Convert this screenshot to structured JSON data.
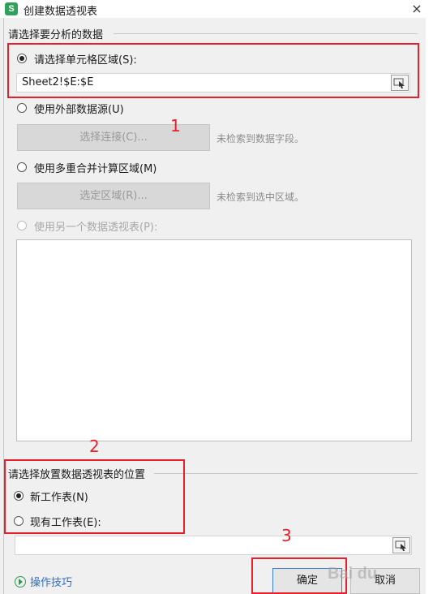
{
  "window": {
    "title": "创建数据透视表",
    "close_glyph": "×"
  },
  "source_section": {
    "heading": "请选择要分析的数据",
    "options": [
      {
        "label": "请选择单元格区域(S):",
        "selected": true,
        "enabled": true
      },
      {
        "label": "使用外部数据源(U)",
        "selected": false,
        "enabled": true
      },
      {
        "label": "使用多重合并计算区域(M)",
        "selected": false,
        "enabled": true
      },
      {
        "label": "使用另一个数据透视表(P):",
        "selected": false,
        "enabled": false
      }
    ],
    "range_value": "Sheet2!$E:$E",
    "select_connection_button": "选择连接(C)...",
    "select_connection_hint": "未检索到数据字段。",
    "select_range_button": "选定区域(R)...",
    "select_range_hint": "未检索到选中区域。"
  },
  "location_section": {
    "heading": "请选择放置数据透视表的位置",
    "options": [
      {
        "label": "新工作表(N)",
        "selected": true
      },
      {
        "label": "现有工作表(E):",
        "selected": false
      }
    ]
  },
  "footer": {
    "tips_label": "操作技巧",
    "ok_label": "确定",
    "cancel_label": "取消"
  },
  "annotations": {
    "marker_1": "1",
    "marker_2": "2",
    "marker_3": "3",
    "highlight_color": "#e8202a"
  },
  "watermark": "Bai du"
}
